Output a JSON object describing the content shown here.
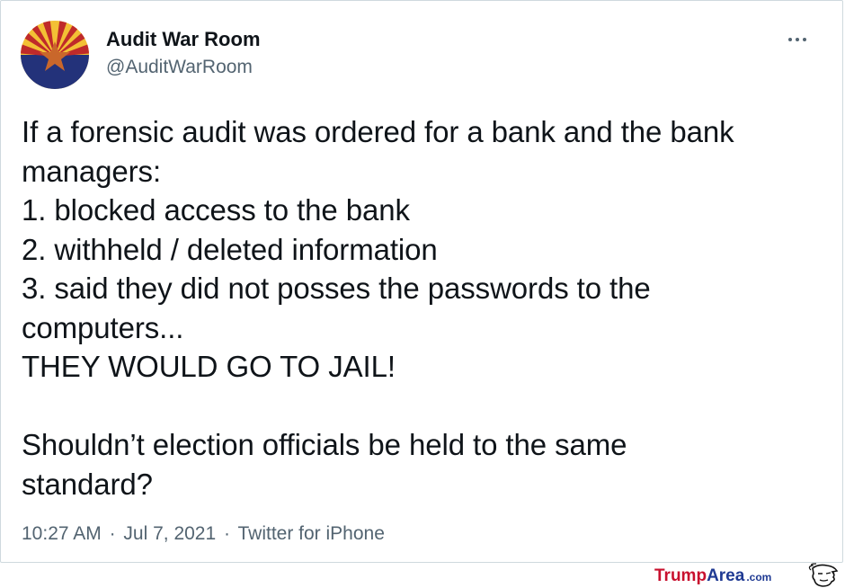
{
  "tweet": {
    "author_name": "Audit War Room",
    "author_handle": "@AuditWarRoom",
    "text": "If a forensic audit was ordered for a bank and the bank\nmanagers:\n1. blocked access to the bank\n2. withheld / deleted information\n3. said they did not posses the passwords to the\ncomputers...\nTHEY WOULD GO TO JAIL!\n\nShouldn’t election officials be held to the same\nstandard?",
    "time": "10:27 AM",
    "separator": "·",
    "date": "Jul 7, 2021",
    "source": "Twitter for iPhone"
  },
  "icons": {
    "avatar": "arizona-flag-avatar",
    "more": "more-options-icon"
  },
  "watermark": {
    "brand_red": "Trump",
    "brand_blue": "Area",
    "suffix": ".com"
  },
  "colors": {
    "text": "#0f1419",
    "secondary": "#536471",
    "border": "#cfd9de",
    "flag_red": "#bf2a2a",
    "flag_yellow": "#f3c035",
    "flag_blue": "#23327a",
    "flag_copper": "#c9672b"
  }
}
